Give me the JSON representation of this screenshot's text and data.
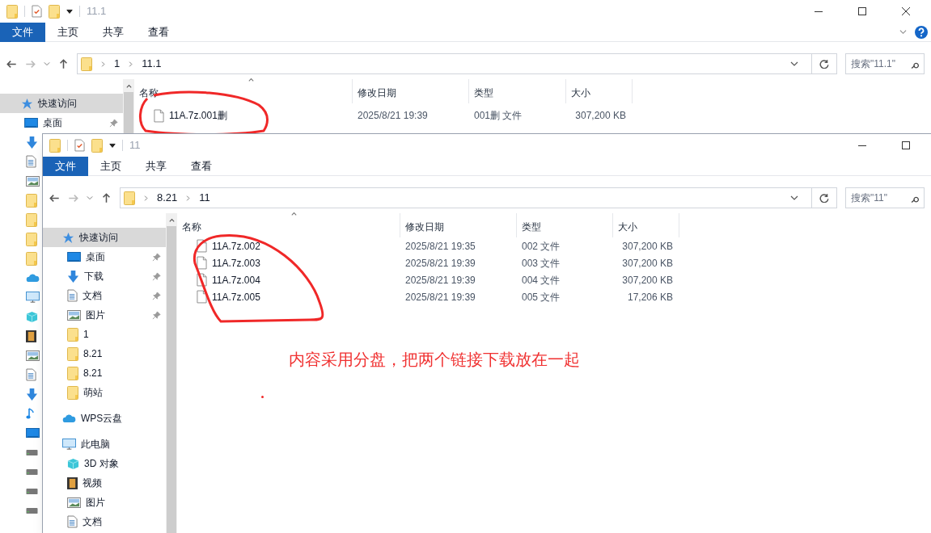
{
  "back_window": {
    "title": "11.1",
    "ribbon_tabs": [
      {
        "label": "文件",
        "selected": true
      },
      {
        "label": "主页",
        "selected": false
      },
      {
        "label": "共享",
        "selected": false
      },
      {
        "label": "查看",
        "selected": false
      }
    ],
    "path": [
      "1",
      "11.1"
    ],
    "search": {
      "placeholder": "搜索\"11.1\""
    },
    "sidebar": [
      {
        "label": "快速访问",
        "kind": "quick",
        "selected": true,
        "pinned": false
      },
      {
        "label": "桌面",
        "kind": "desktop",
        "selected": false,
        "pinned": true
      }
    ],
    "columns": [
      "名称",
      "修改日期",
      "类型",
      "大小"
    ],
    "files": [
      {
        "name": "11A.7z.001删",
        "modified": "2025/8/21 19:39",
        "type": "001删 文件",
        "size": "307,200 KB"
      }
    ]
  },
  "front_window": {
    "title": "11",
    "ribbon_tabs": [
      {
        "label": "文件",
        "selected": true
      },
      {
        "label": "主页",
        "selected": false
      },
      {
        "label": "共享",
        "selected": false
      },
      {
        "label": "查看",
        "selected": false
      }
    ],
    "path": [
      "8.21",
      "11"
    ],
    "search": {
      "placeholder": "搜索\"11\""
    },
    "sidebar": [
      {
        "label": "快速访问",
        "kind": "quick",
        "selected": true,
        "pinned": false,
        "children": [
          {
            "label": "桌面",
            "kind": "desktop",
            "selected": false,
            "pinned": true
          },
          {
            "label": "下载",
            "kind": "download",
            "selected": false,
            "pinned": true
          },
          {
            "label": "文档",
            "kind": "document",
            "selected": false,
            "pinned": true
          },
          {
            "label": "图片",
            "kind": "picture",
            "selected": false,
            "pinned": true
          },
          {
            "label": "1",
            "kind": "folder",
            "selected": false,
            "pinned": false
          },
          {
            "label": "8.21",
            "kind": "folder",
            "selected": false,
            "pinned": false
          },
          {
            "label": "8.21",
            "kind": "folder",
            "selected": false,
            "pinned": false
          },
          {
            "label": "萌站",
            "kind": "folder",
            "selected": false,
            "pinned": false
          }
        ]
      },
      {
        "label": "WPS云盘",
        "kind": "cloud",
        "selected": false,
        "pinned": false
      },
      {
        "label": "此电脑",
        "kind": "pc",
        "selected": false,
        "pinned": false,
        "children": [
          {
            "label": "3D 对象",
            "kind": "cube",
            "selected": false,
            "pinned": false
          },
          {
            "label": "视频",
            "kind": "video",
            "selected": false,
            "pinned": false
          },
          {
            "label": "图片",
            "kind": "picture",
            "selected": false,
            "pinned": false
          },
          {
            "label": "文档",
            "kind": "document",
            "selected": false,
            "pinned": false
          }
        ]
      }
    ],
    "columns": [
      "名称",
      "修改日期",
      "类型",
      "大小"
    ],
    "files": [
      {
        "name": "11A.7z.002",
        "modified": "2025/8/21 19:35",
        "type": "002 文件",
        "size": "307,200 KB"
      },
      {
        "name": "11A.7z.003",
        "modified": "2025/8/21 19:39",
        "type": "003 文件",
        "size": "307,200 KB"
      },
      {
        "name": "11A.7z.004",
        "modified": "2025/8/21 19:39",
        "type": "004 文件",
        "size": "307,200 KB"
      },
      {
        "name": "11A.7z.005",
        "modified": "2025/8/21 19:39",
        "type": "005 文件",
        "size": "17,206 KB"
      }
    ]
  },
  "annotation": {
    "note": "内容采用分盘，把两个链接下载放在一起"
  }
}
